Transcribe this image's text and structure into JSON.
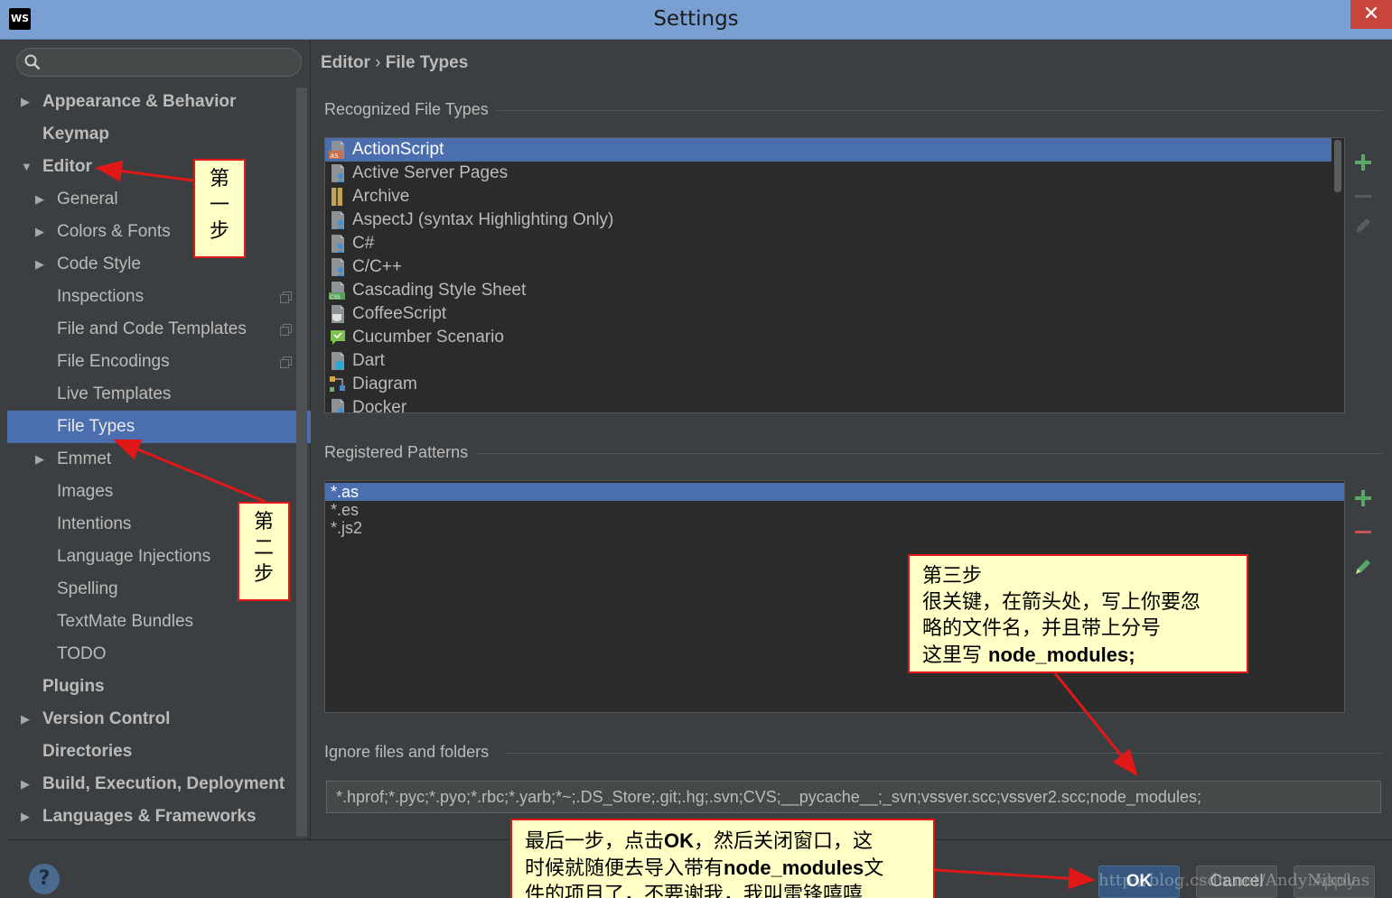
{
  "window": {
    "app_logo": "WS",
    "title": "Settings",
    "close_glyph": "✕"
  },
  "sidebar": {
    "search_placeholder": "",
    "items": [
      {
        "label": "Appearance & Behavior",
        "level": 0,
        "arrow": "right",
        "bold": true
      },
      {
        "label": "Keymap",
        "level": 0,
        "arrow": "",
        "bold": true
      },
      {
        "label": "Editor",
        "level": 0,
        "arrow": "down",
        "bold": true
      },
      {
        "label": "General",
        "level": 1,
        "arrow": "right"
      },
      {
        "label": "Colors & Fonts",
        "level": 1,
        "arrow": "right"
      },
      {
        "label": "Code Style",
        "level": 1,
        "arrow": "right"
      },
      {
        "label": "Inspections",
        "level": 1,
        "arrow": "",
        "copy": true
      },
      {
        "label": "File and Code Templates",
        "level": 1,
        "arrow": "",
        "copy": true
      },
      {
        "label": "File Encodings",
        "level": 1,
        "arrow": "",
        "copy": true
      },
      {
        "label": "Live Templates",
        "level": 1,
        "arrow": ""
      },
      {
        "label": "File Types",
        "level": 1,
        "arrow": "",
        "selected": true
      },
      {
        "label": "Emmet",
        "level": 1,
        "arrow": "right"
      },
      {
        "label": "Images",
        "level": 1,
        "arrow": ""
      },
      {
        "label": "Intentions",
        "level": 1,
        "arrow": ""
      },
      {
        "label": "Language Injections",
        "level": 1,
        "arrow": ""
      },
      {
        "label": "Spelling",
        "level": 1,
        "arrow": ""
      },
      {
        "label": "TextMate Bundles",
        "level": 1,
        "arrow": ""
      },
      {
        "label": "TODO",
        "level": 1,
        "arrow": ""
      },
      {
        "label": "Plugins",
        "level": 0,
        "arrow": "",
        "bold": true
      },
      {
        "label": "Version Control",
        "level": 0,
        "arrow": "right",
        "bold": true
      },
      {
        "label": "Directories",
        "level": 0,
        "arrow": "",
        "bold": true
      },
      {
        "label": "Build, Execution, Deployment",
        "level": 0,
        "arrow": "right",
        "bold": true
      },
      {
        "label": "Languages & Frameworks",
        "level": 0,
        "arrow": "right",
        "bold": true
      }
    ]
  },
  "breadcrumb": {
    "parent": "Editor",
    "separator": "›",
    "current": "File Types"
  },
  "recognized": {
    "title": "Recognized File Types",
    "items": [
      {
        "label": "ActionScript",
        "icon": "actionscript-file-icon",
        "selected": true
      },
      {
        "label": "Active Server Pages",
        "icon": "asp-file-icon"
      },
      {
        "label": "Archive",
        "icon": "archive-file-icon"
      },
      {
        "label": "AspectJ (syntax Highlighting Only)",
        "icon": "aspectj-file-icon"
      },
      {
        "label": "C#",
        "icon": "csharp-file-icon"
      },
      {
        "label": "C/C++",
        "icon": "cpp-file-icon"
      },
      {
        "label": "Cascading Style Sheet",
        "icon": "css-file-icon"
      },
      {
        "label": "CoffeeScript",
        "icon": "coffeescript-file-icon"
      },
      {
        "label": "Cucumber Scenario",
        "icon": "cucumber-file-icon"
      },
      {
        "label": "Dart",
        "icon": "dart-file-icon"
      },
      {
        "label": "Diagram",
        "icon": "diagram-file-icon"
      },
      {
        "label": "Docker",
        "icon": "docker-file-icon"
      }
    ]
  },
  "patterns": {
    "title": "Registered Patterns",
    "items": [
      {
        "label": "*.as",
        "selected": true
      },
      {
        "label": "*.es"
      },
      {
        "label": "*.js2"
      }
    ]
  },
  "ignore": {
    "title": "Ignore files and folders",
    "value": "*.hprof;*.pyc;*.pyo;*.rbc;*.yarb;*~;.DS_Store;.git;.hg;.svn;CVS;__pycache__;_svn;vssver.scc;vssver2.scc;node_modules;"
  },
  "buttons": {
    "help": "?",
    "ok": "OK",
    "cancel": "Cancel",
    "apply": "Apply"
  },
  "watermark": "http://blog.csdn.net/AndyNikolas",
  "annotations": {
    "step1": [
      "第",
      "一",
      "步"
    ],
    "step2": [
      "第",
      "二",
      "步"
    ],
    "step3": {
      "line1": "第三步",
      "line2": "很关键，在箭头处，写上你要忽",
      "line3": "略的文件名，并且带上分号",
      "line4_prefix": "这里写 ",
      "line4_bold": "node_modules;"
    },
    "step4": {
      "line1_a": "最后一步，点击",
      "line1_b": "OK",
      "line1_c": "，然后关闭窗口，这",
      "line2_a": "时候就随便去导入带有",
      "line2_b": "node_modules",
      "line2_c": "文",
      "line3": "件的项目了，不要谢我，我叫雷锋嘻嘻"
    }
  },
  "colors": {
    "selection": "#4b6eaf",
    "background": "#3c3f41",
    "list_bg": "#2b2b2b",
    "add": "#59a869",
    "remove": "#c75450",
    "annotation_border": "#e01818",
    "annotation_fill": "#ffffc6"
  }
}
